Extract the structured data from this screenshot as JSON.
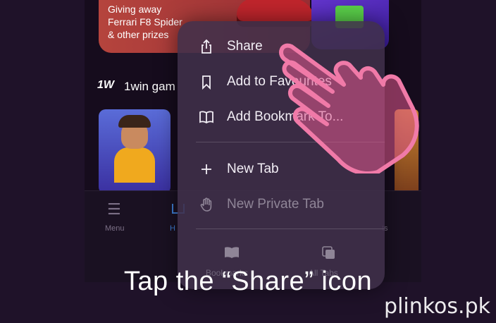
{
  "background": {
    "promo_text_lines": [
      "Giving away",
      "Ferrari F8 Spider",
      "& other prizes"
    ],
    "games_logo": "1W",
    "games_title": "1win gam",
    "tabbar": {
      "menu_label": "Menu",
      "home_label": "H",
      "right_label": "ts"
    }
  },
  "menu": {
    "items": [
      {
        "label": "Share",
        "icon": "share-icon"
      },
      {
        "label": "Add to Favourites",
        "icon": "bookmark-icon"
      },
      {
        "label": "Add Bookmark To...",
        "icon": "book-icon"
      },
      {
        "label": "New Tab",
        "icon": "plus-icon"
      },
      {
        "label": "New Private Tab",
        "icon": "hand-icon"
      }
    ],
    "bottom": [
      {
        "label": "Bookmarks",
        "icon": "book-icon"
      },
      {
        "label": "All Tabs",
        "icon": "tabs-icon"
      }
    ]
  },
  "caption": "Tap the “Share” icon",
  "watermark": "plinkos.pk",
  "colors": {
    "accent_pink": "#e0588e",
    "background": "#1f1229"
  }
}
